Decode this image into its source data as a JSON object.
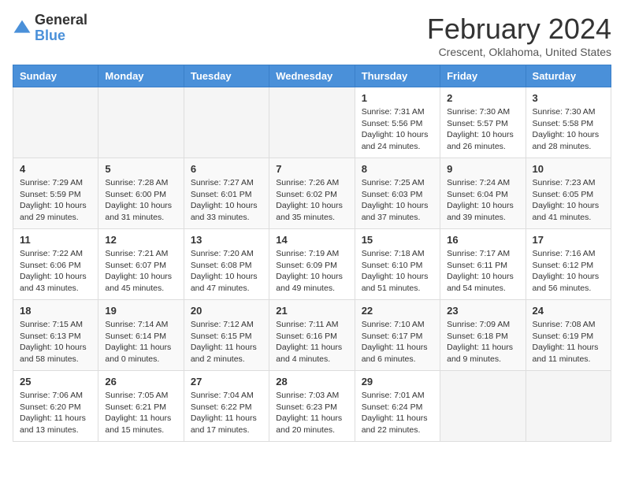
{
  "logo": {
    "general": "General",
    "blue": "Blue"
  },
  "title": "February 2024",
  "subtitle": "Crescent, Oklahoma, United States",
  "days_of_week": [
    "Sunday",
    "Monday",
    "Tuesday",
    "Wednesday",
    "Thursday",
    "Friday",
    "Saturday"
  ],
  "weeks": [
    [
      {
        "day": "",
        "info": ""
      },
      {
        "day": "",
        "info": ""
      },
      {
        "day": "",
        "info": ""
      },
      {
        "day": "",
        "info": ""
      },
      {
        "day": "1",
        "info": "Sunrise: 7:31 AM\nSunset: 5:56 PM\nDaylight: 10 hours\nand 24 minutes."
      },
      {
        "day": "2",
        "info": "Sunrise: 7:30 AM\nSunset: 5:57 PM\nDaylight: 10 hours\nand 26 minutes."
      },
      {
        "day": "3",
        "info": "Sunrise: 7:30 AM\nSunset: 5:58 PM\nDaylight: 10 hours\nand 28 minutes."
      }
    ],
    [
      {
        "day": "4",
        "info": "Sunrise: 7:29 AM\nSunset: 5:59 PM\nDaylight: 10 hours\nand 29 minutes."
      },
      {
        "day": "5",
        "info": "Sunrise: 7:28 AM\nSunset: 6:00 PM\nDaylight: 10 hours\nand 31 minutes."
      },
      {
        "day": "6",
        "info": "Sunrise: 7:27 AM\nSunset: 6:01 PM\nDaylight: 10 hours\nand 33 minutes."
      },
      {
        "day": "7",
        "info": "Sunrise: 7:26 AM\nSunset: 6:02 PM\nDaylight: 10 hours\nand 35 minutes."
      },
      {
        "day": "8",
        "info": "Sunrise: 7:25 AM\nSunset: 6:03 PM\nDaylight: 10 hours\nand 37 minutes."
      },
      {
        "day": "9",
        "info": "Sunrise: 7:24 AM\nSunset: 6:04 PM\nDaylight: 10 hours\nand 39 minutes."
      },
      {
        "day": "10",
        "info": "Sunrise: 7:23 AM\nSunset: 6:05 PM\nDaylight: 10 hours\nand 41 minutes."
      }
    ],
    [
      {
        "day": "11",
        "info": "Sunrise: 7:22 AM\nSunset: 6:06 PM\nDaylight: 10 hours\nand 43 minutes."
      },
      {
        "day": "12",
        "info": "Sunrise: 7:21 AM\nSunset: 6:07 PM\nDaylight: 10 hours\nand 45 minutes."
      },
      {
        "day": "13",
        "info": "Sunrise: 7:20 AM\nSunset: 6:08 PM\nDaylight: 10 hours\nand 47 minutes."
      },
      {
        "day": "14",
        "info": "Sunrise: 7:19 AM\nSunset: 6:09 PM\nDaylight: 10 hours\nand 49 minutes."
      },
      {
        "day": "15",
        "info": "Sunrise: 7:18 AM\nSunset: 6:10 PM\nDaylight: 10 hours\nand 51 minutes."
      },
      {
        "day": "16",
        "info": "Sunrise: 7:17 AM\nSunset: 6:11 PM\nDaylight: 10 hours\nand 54 minutes."
      },
      {
        "day": "17",
        "info": "Sunrise: 7:16 AM\nSunset: 6:12 PM\nDaylight: 10 hours\nand 56 minutes."
      }
    ],
    [
      {
        "day": "18",
        "info": "Sunrise: 7:15 AM\nSunset: 6:13 PM\nDaylight: 10 hours\nand 58 minutes."
      },
      {
        "day": "19",
        "info": "Sunrise: 7:14 AM\nSunset: 6:14 PM\nDaylight: 11 hours\nand 0 minutes."
      },
      {
        "day": "20",
        "info": "Sunrise: 7:12 AM\nSunset: 6:15 PM\nDaylight: 11 hours\nand 2 minutes."
      },
      {
        "day": "21",
        "info": "Sunrise: 7:11 AM\nSunset: 6:16 PM\nDaylight: 11 hours\nand 4 minutes."
      },
      {
        "day": "22",
        "info": "Sunrise: 7:10 AM\nSunset: 6:17 PM\nDaylight: 11 hours\nand 6 minutes."
      },
      {
        "day": "23",
        "info": "Sunrise: 7:09 AM\nSunset: 6:18 PM\nDaylight: 11 hours\nand 9 minutes."
      },
      {
        "day": "24",
        "info": "Sunrise: 7:08 AM\nSunset: 6:19 PM\nDaylight: 11 hours\nand 11 minutes."
      }
    ],
    [
      {
        "day": "25",
        "info": "Sunrise: 7:06 AM\nSunset: 6:20 PM\nDaylight: 11 hours\nand 13 minutes."
      },
      {
        "day": "26",
        "info": "Sunrise: 7:05 AM\nSunset: 6:21 PM\nDaylight: 11 hours\nand 15 minutes."
      },
      {
        "day": "27",
        "info": "Sunrise: 7:04 AM\nSunset: 6:22 PM\nDaylight: 11 hours\nand 17 minutes."
      },
      {
        "day": "28",
        "info": "Sunrise: 7:03 AM\nSunset: 6:23 PM\nDaylight: 11 hours\nand 20 minutes."
      },
      {
        "day": "29",
        "info": "Sunrise: 7:01 AM\nSunset: 6:24 PM\nDaylight: 11 hours\nand 22 minutes."
      },
      {
        "day": "",
        "info": ""
      },
      {
        "day": "",
        "info": ""
      }
    ]
  ]
}
